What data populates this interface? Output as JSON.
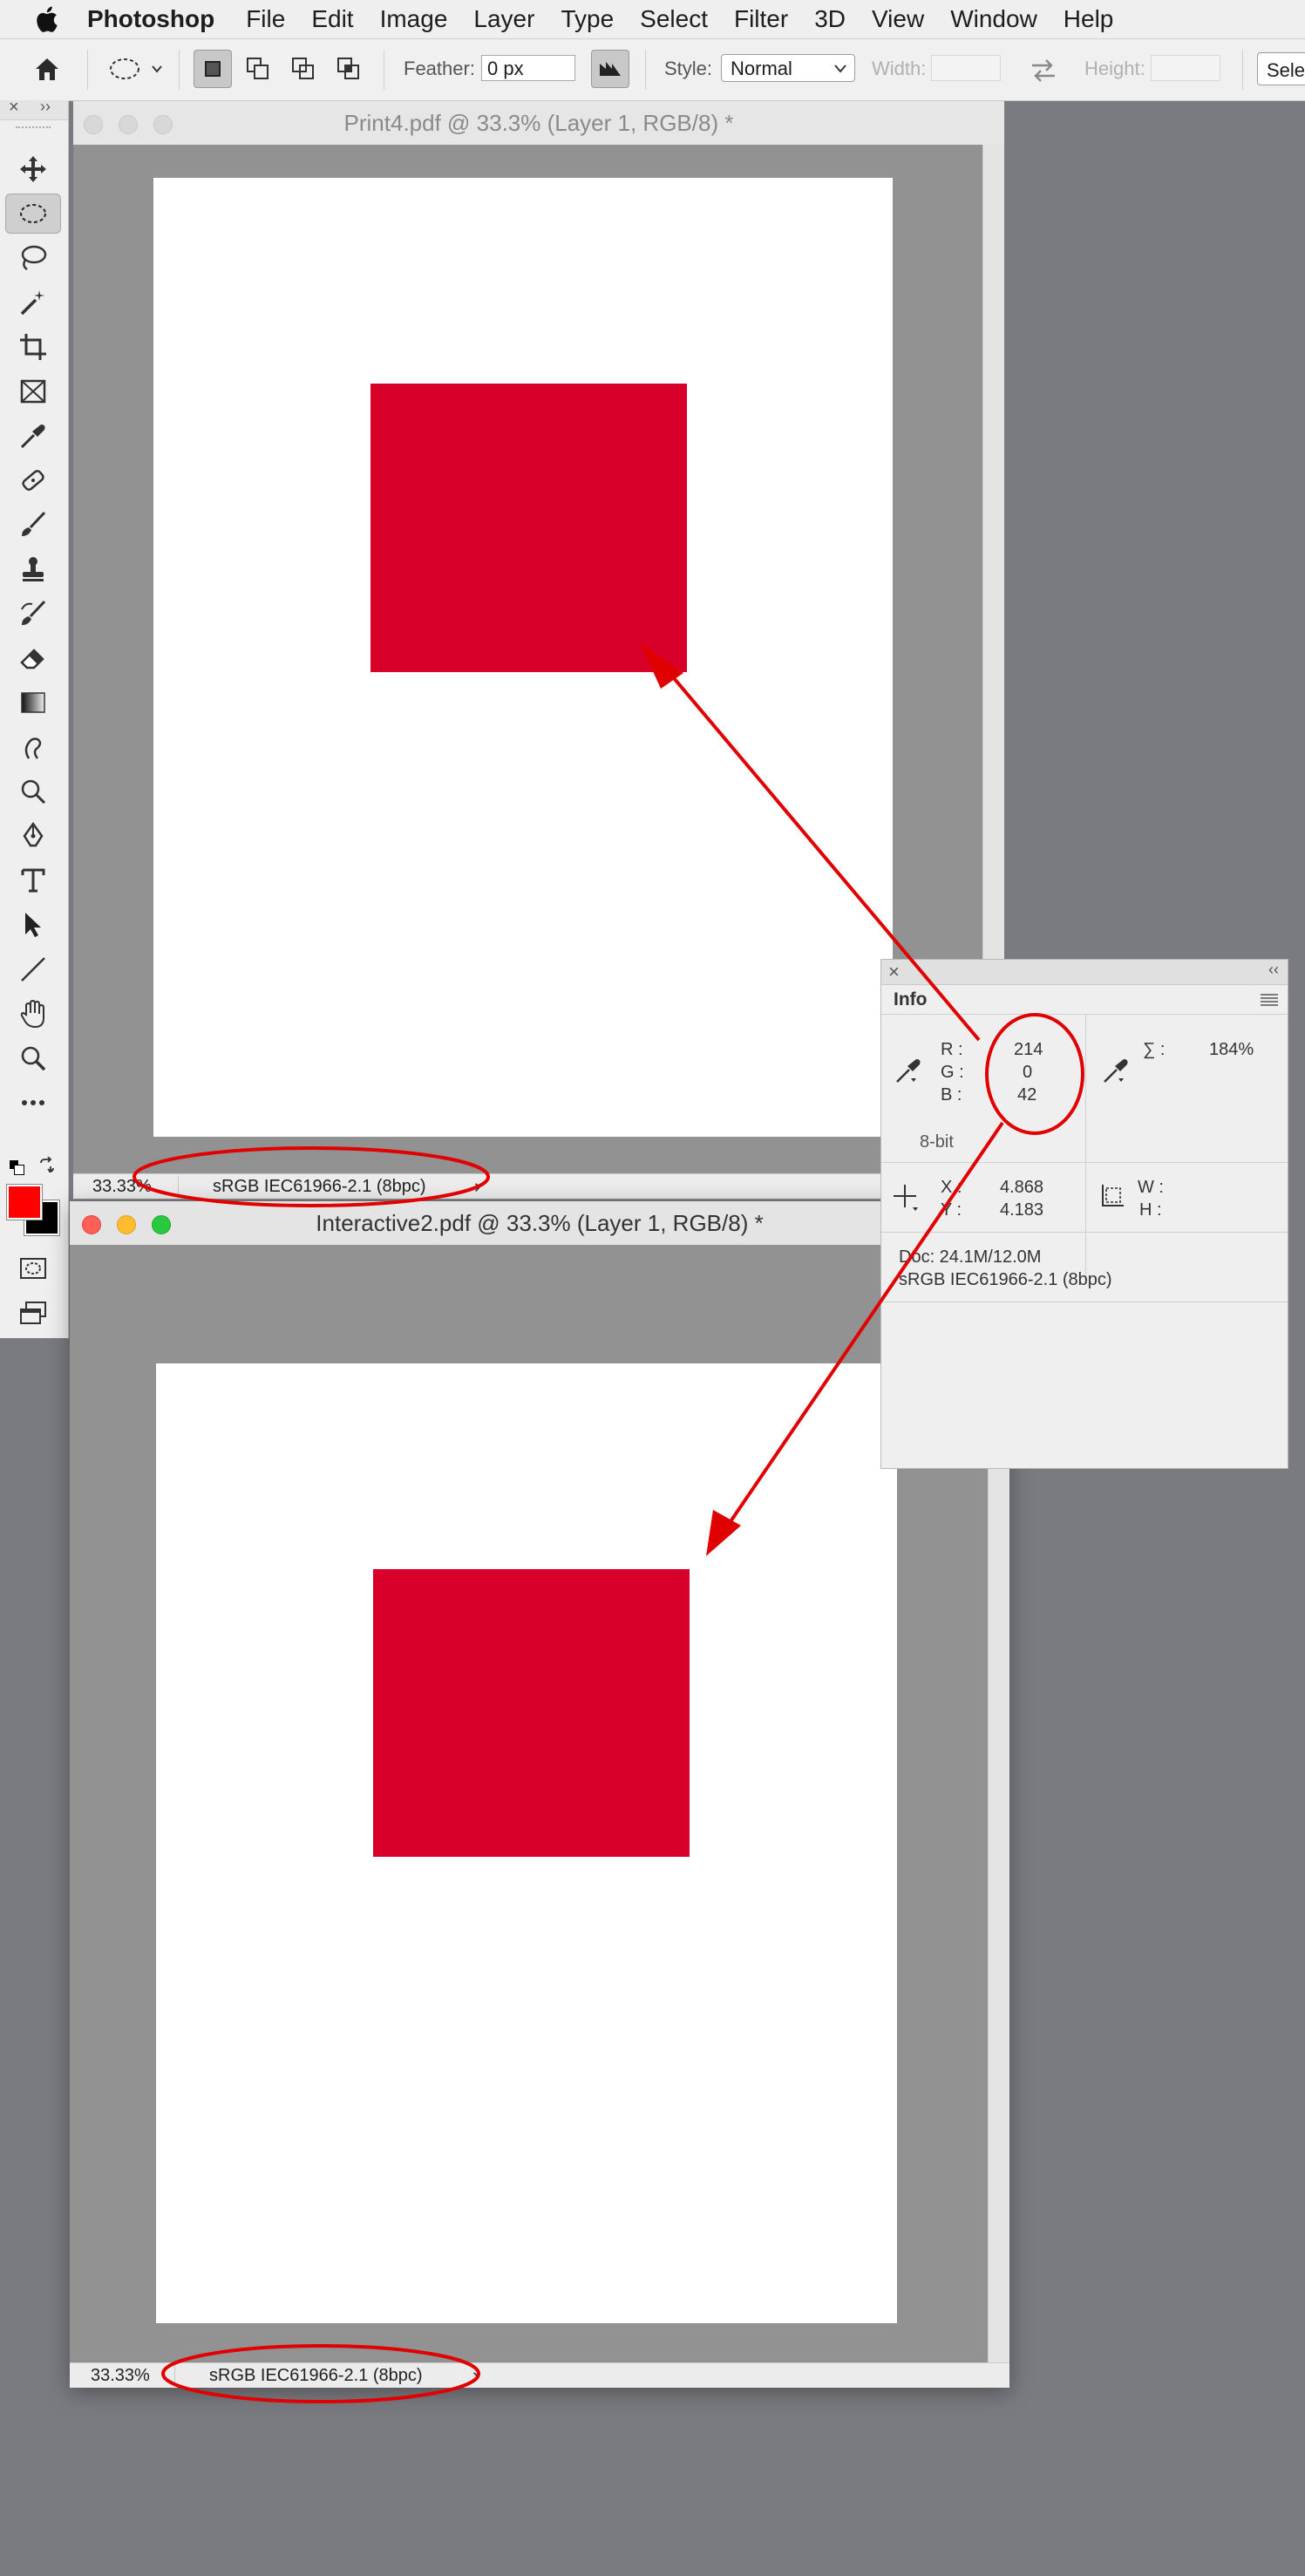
{
  "menubar": {
    "app_name": "Photoshop",
    "items": [
      "File",
      "Edit",
      "Image",
      "Layer",
      "Type",
      "Select",
      "Filter",
      "3D",
      "View",
      "Window",
      "Help"
    ]
  },
  "options": {
    "feather_label": "Feather:",
    "feather_value": "0 px",
    "style_label": "Style:",
    "style_value": "Normal",
    "width_label": "Width:",
    "height_label": "Height:",
    "select_button": "Sele"
  },
  "doc1": {
    "title": "Print4.pdf @ 33.3% (Layer 1, RGB/8) *",
    "zoom": "33.33%",
    "profile": "sRGB IEC61966-2.1 (8bpc)",
    "chevron": "›"
  },
  "doc2": {
    "title": "Interactive2.pdf @ 33.3% (Layer 1, RGB/8) *",
    "zoom": "33.33%",
    "profile": "sRGB IEC61966-2.1 (8bpc)",
    "chevron": "›"
  },
  "info_panel": {
    "tab": "Info",
    "r_label": "R :",
    "r_value": "214",
    "g_label": "G :",
    "g_value": "0",
    "b_label": "B :",
    "b_value": "42",
    "bit_depth": "8-bit",
    "sigma_label": "∑ :",
    "sigma_value": "184%",
    "x_label": "X :",
    "x_value": "4.868",
    "y_label": "Y :",
    "y_value": "4.183",
    "w_label": "W :",
    "h_label": "H :",
    "doc_size": "Doc: 24.1M/12.0M",
    "doc_profile": "sRGB IEC61966-2.1 (8bpc)"
  },
  "colors": {
    "foreground": "#d8002a",
    "background": "#000000",
    "annotation": "#e00000"
  }
}
